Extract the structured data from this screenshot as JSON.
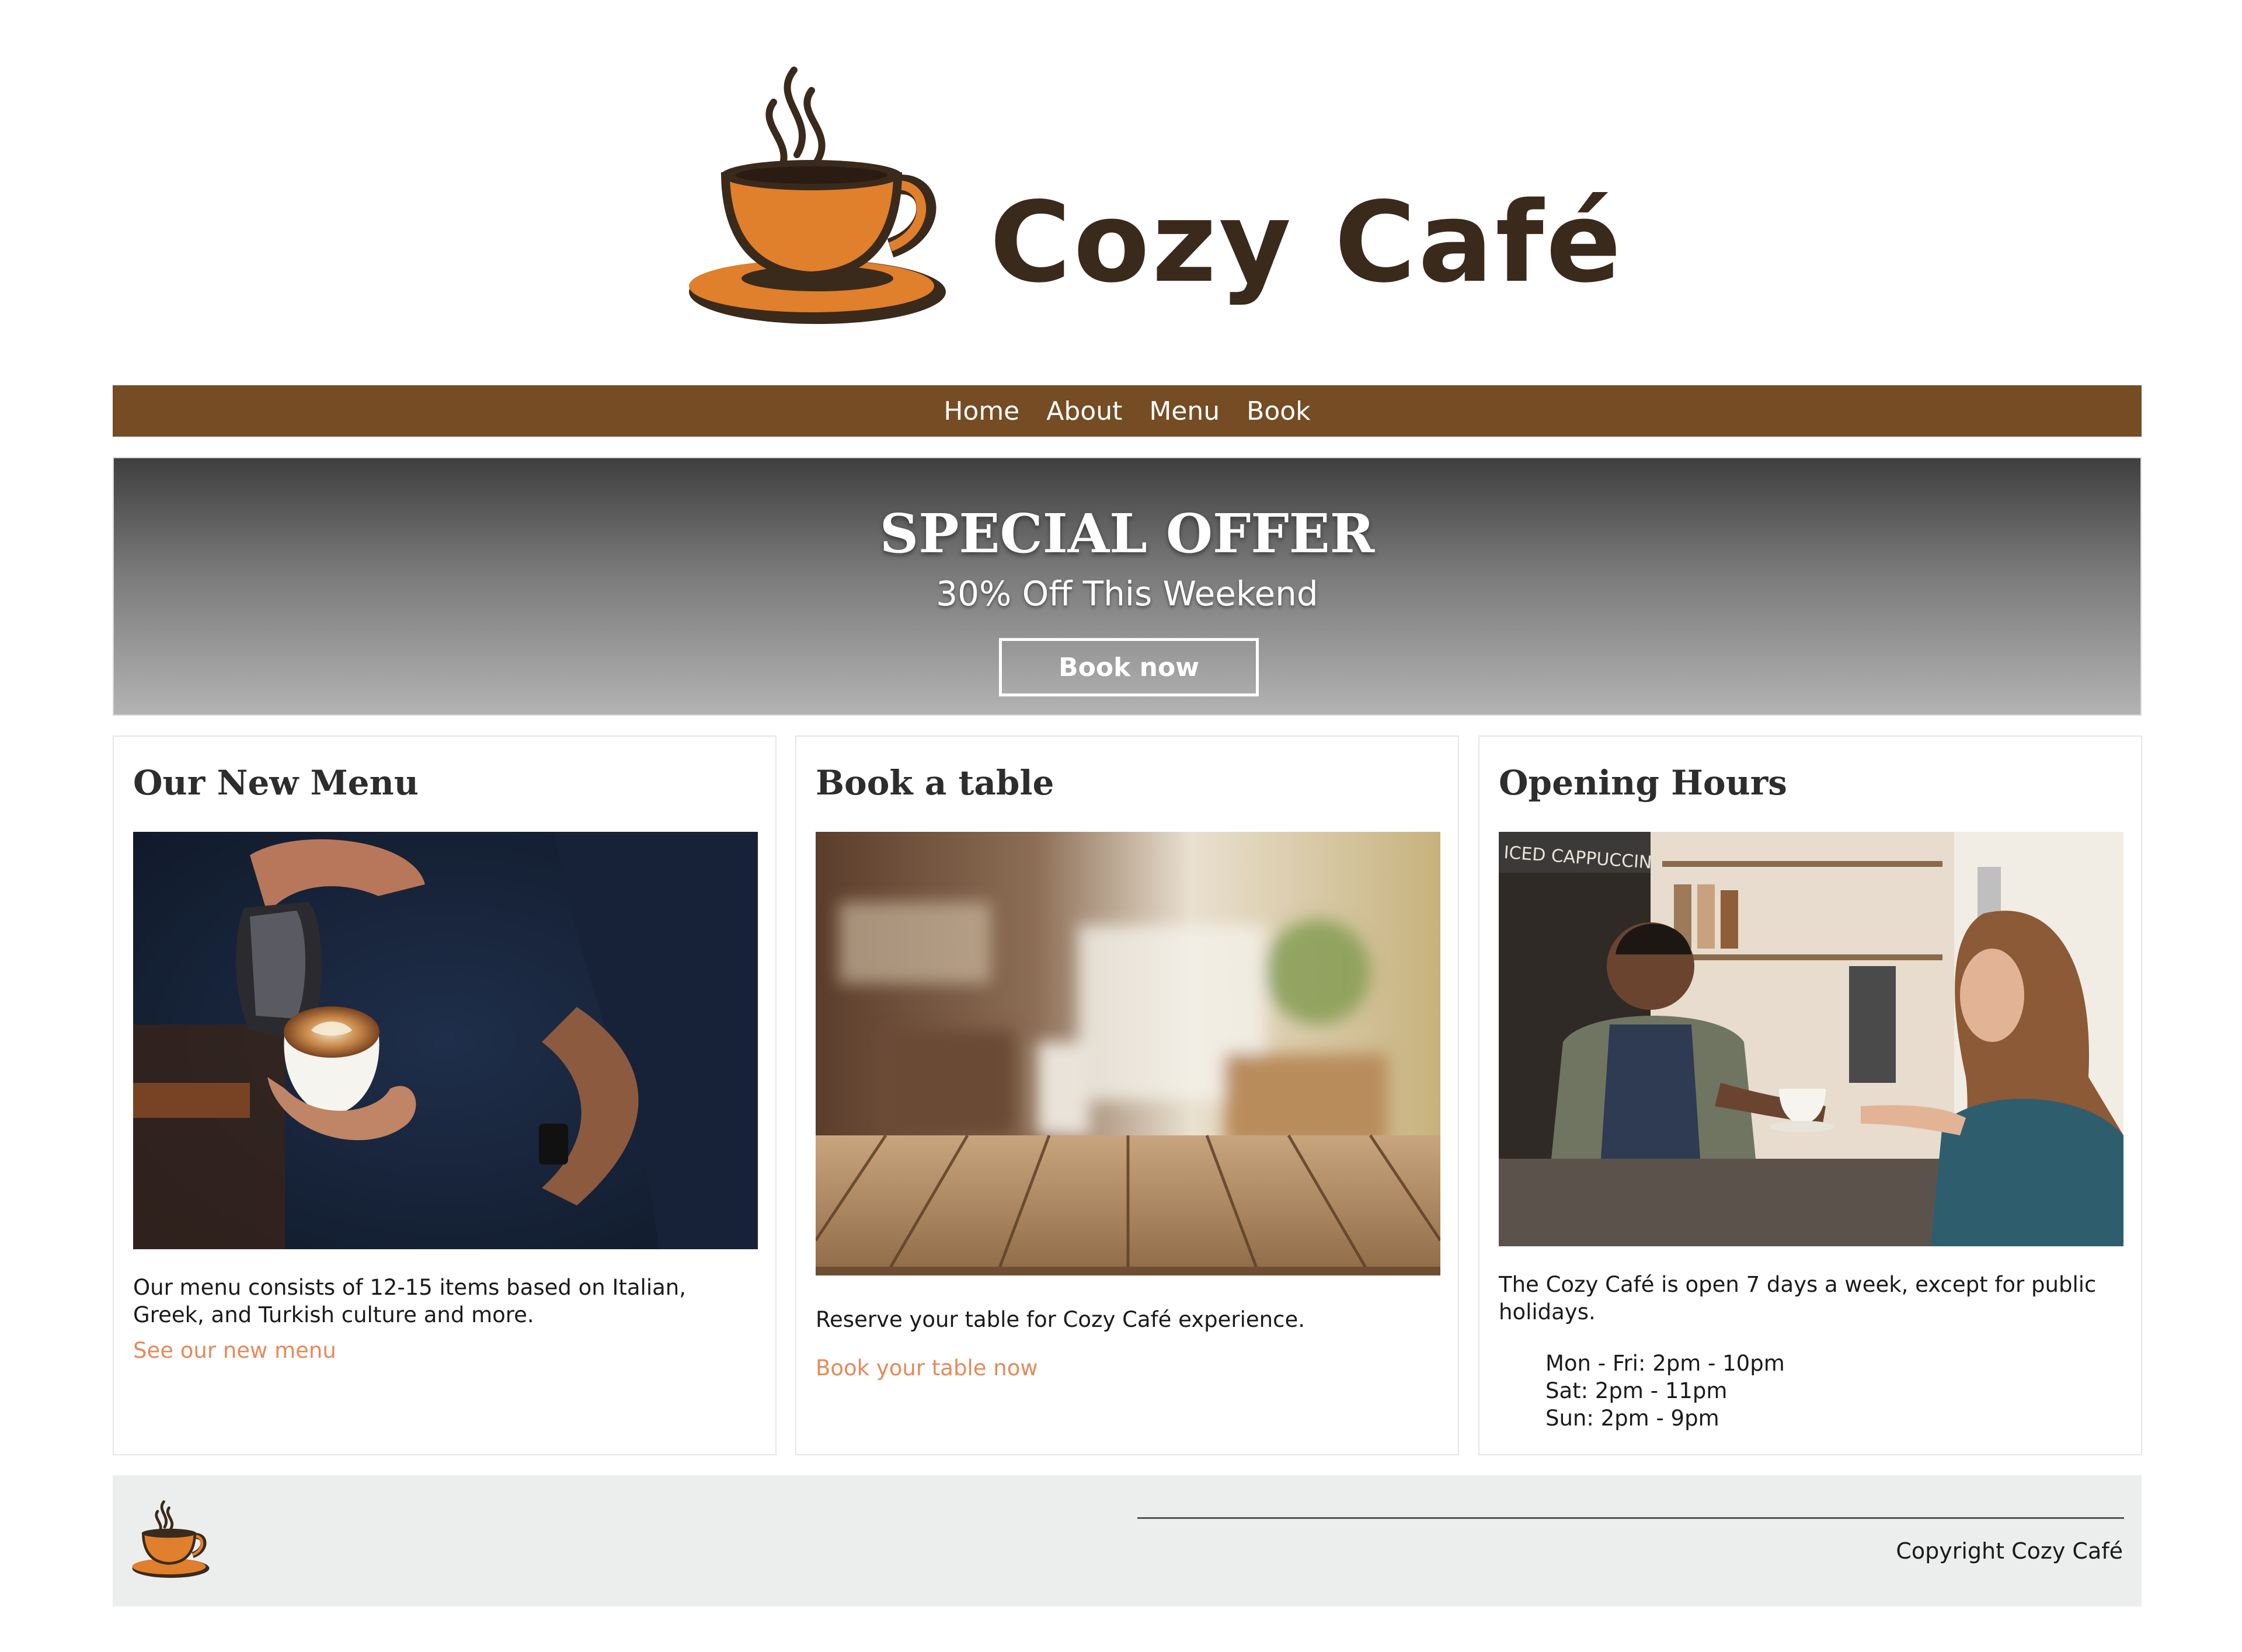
{
  "brand": {
    "name": "Cozy Café",
    "logo_icon": "coffee-cup-icon",
    "colors": {
      "cup": "#e07f2c",
      "outline": "#3a2a1c",
      "nav": "#754c24",
      "link": "#e58a5a"
    }
  },
  "nav": {
    "items": [
      {
        "label": "Home"
      },
      {
        "label": "About"
      },
      {
        "label": "Menu"
      },
      {
        "label": "Book"
      }
    ]
  },
  "hero": {
    "title": "SPECIAL OFFER",
    "subtitle": "30% Off This Weekend",
    "button_label": "Book now"
  },
  "cards": [
    {
      "title": "Our New Menu",
      "image": "barista-pouring-latte-art",
      "text": "Our menu consists of 12-15 items based on Italian, Greek, and Turkish culture and more.",
      "link": "See our new menu"
    },
    {
      "title": "Book a table",
      "image": "wooden-table-blurred-cafe",
      "text": "Reserve your table for Cozy Café experience.",
      "link": "Book your table now"
    },
    {
      "title": "Opening Hours",
      "image": "barista-serving-customer",
      "image_sign": "ICED CAPPUCCINO",
      "text": "The Cozy Café is open 7 days a week, except for public holidays.",
      "hours": [
        "Mon - Fri: 2pm - 10pm",
        "Sat: 2pm - 11pm",
        "Sun: 2pm - 9pm"
      ]
    }
  ],
  "footer": {
    "copyright": "Copyright Cozy Café",
    "logo_icon": "coffee-cup-icon"
  }
}
